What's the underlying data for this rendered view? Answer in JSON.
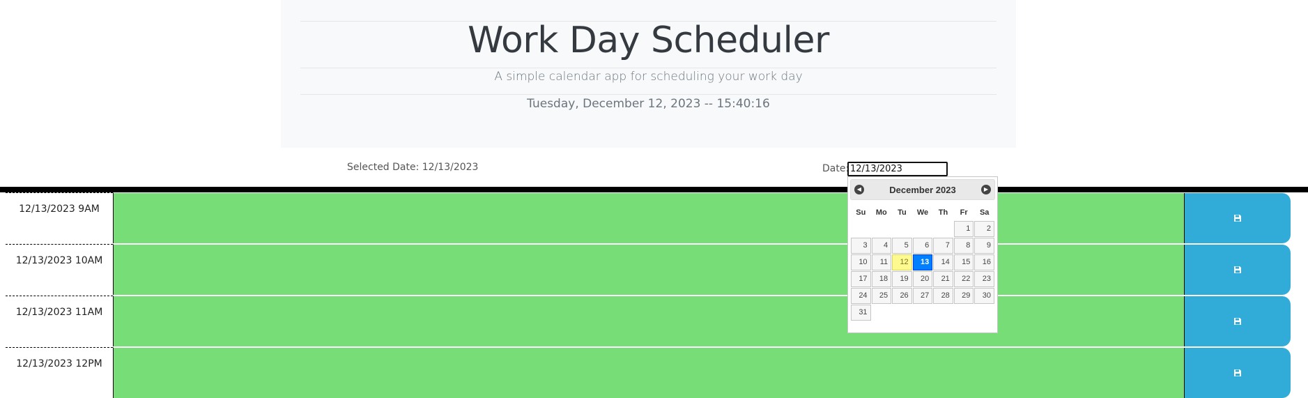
{
  "header": {
    "title": "Work Day Scheduler",
    "subtitle": "A simple calendar app for scheduling your work day",
    "current_datetime": "Tuesday, December 12, 2023 -- 15:40:16"
  },
  "selected_date_text": "Selected Date: 12/13/2023",
  "date_picker": {
    "label": "Date:",
    "value": "12/13/2023",
    "month_title": "December 2023",
    "prev_icon": "chevron-left-icon",
    "next_icon": "chevron-right-icon",
    "weekdays": [
      "Su",
      "Mo",
      "Tu",
      "We",
      "Th",
      "Fr",
      "Sa"
    ],
    "weeks": [
      [
        "",
        "",
        "",
        "",
        "",
        "1",
        "2"
      ],
      [
        "3",
        "4",
        "5",
        "6",
        "7",
        "8",
        "9"
      ],
      [
        "10",
        "11",
        "12",
        "13",
        "14",
        "15",
        "16"
      ],
      [
        "17",
        "18",
        "19",
        "20",
        "21",
        "22",
        "23"
      ],
      [
        "24",
        "25",
        "26",
        "27",
        "28",
        "29",
        "30"
      ],
      [
        "31",
        "",
        "",
        "",
        "",
        "",
        ""
      ]
    ],
    "today": "12",
    "selected": "13"
  },
  "time_blocks": [
    {
      "hour_label": "12/13/2023 9AM",
      "text": ""
    },
    {
      "hour_label": "12/13/2023 10AM",
      "text": ""
    },
    {
      "hour_label": "12/13/2023 11AM",
      "text": ""
    },
    {
      "hour_label": "12/13/2023 12PM",
      "text": ""
    }
  ],
  "save_icon": "floppy-disk-icon",
  "colors": {
    "future_block": "#77dd77",
    "save_button": "#31acd8",
    "today_highlight": "#fffa90",
    "selected_day": "#007fff"
  }
}
